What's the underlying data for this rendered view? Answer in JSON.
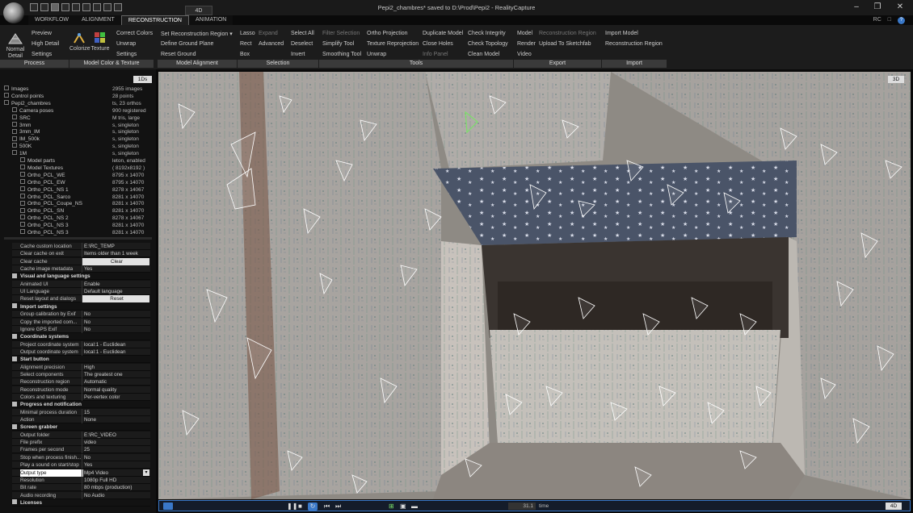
{
  "app": {
    "window_title": "Pepi2_chambres* saved to D:\\Prod\\Pepi2 - RealityCapture",
    "mode_label": "4D",
    "accent": "#3a78c8"
  },
  "tabs": [
    "WORKFLOW",
    "ALIGNMENT",
    "RECONSTRUCTION",
    "ANIMATION"
  ],
  "tab_icons": [
    "RC",
    "doc-icon",
    "help-icon"
  ],
  "ribbon": {
    "process": {
      "label": "Process",
      "normal_detail": "Normal Detail",
      "preview": "Preview",
      "high_detail": "High Detail",
      "settings": "Settings"
    },
    "model_color": {
      "label": "Model Color & Texture",
      "colorize": "Colorize",
      "texture": "Texture",
      "correct_colors": "Correct Colors",
      "unwrap": "Unwrap",
      "settings": "Settings"
    },
    "model_alignment": {
      "label": "Model Alignment",
      "set_region": "Set Reconstruction Region",
      "define_ground": "Define Ground Plane",
      "reset_ground": "Reset Ground"
    },
    "selection": {
      "label": "Selection",
      "lasso": "Lasso",
      "expand": "Expand",
      "rect": "Rect",
      "advanced": "Advanced",
      "box": "Box",
      "select_all": "Select All",
      "deselect": "Deselect",
      "invert": "Invert"
    },
    "tools": {
      "label": "Tools",
      "filter_selection": "Filter Selection",
      "simplify_tool": "Simplify Tool",
      "smoothing_tool": "Smoothing Tool",
      "ortho_projection": "Ortho Projection",
      "texture_reprojection": "Texture Reprojection",
      "unwrap": "Unwrap",
      "duplicate_model": "Duplicate Model",
      "close_holes": "Close Holes",
      "info_panel": "Info Panel",
      "check_integrity": "Check Integrity",
      "check_topology": "Check Topology",
      "clean_model": "Clean Model"
    },
    "export": {
      "label": "Export",
      "model": "Model",
      "reconstruction_region": "Reconstruction Region",
      "render": "Render",
      "upload_sketchfab": "Upload To Sketchfab",
      "video": "Video"
    },
    "import": {
      "label": "Import",
      "import_model": "Import Model",
      "reconstruction_region": "Reconstruction Region"
    }
  },
  "tree": {
    "badge": "1Ds",
    "rows": [
      {
        "name": "Images",
        "value": "2955 images",
        "level": 0
      },
      {
        "name": "Control points",
        "value": "28 points",
        "level": 0
      },
      {
        "name": "Pepi2_chambres",
        "value": "ts, 23 orthos",
        "level": 0
      },
      {
        "name": "Camera poses",
        "value": "900 registered",
        "level": 1
      },
      {
        "name": "SRC",
        "value": "M tris, large",
        "level": 1
      },
      {
        "name": "3mm",
        "value": "s, singleton",
        "level": 1
      },
      {
        "name": "3mm_IM",
        "value": "s, singleton",
        "level": 1
      },
      {
        "name": "IM_500k",
        "value": "s, singleton",
        "level": 1
      },
      {
        "name": "500K",
        "value": "s, singleton",
        "level": 1
      },
      {
        "name": "1M",
        "value": "s, singleton",
        "level": 1
      },
      {
        "name": "Model parts",
        "value": "leton, enabled",
        "level": 2
      },
      {
        "name": "Model Textures",
        "value": "( 8192x8192 )",
        "level": 2
      },
      {
        "name": "Ortho_PCL_WE",
        "value": "8795 x 14070",
        "level": 2
      },
      {
        "name": "Ortho_PCL_EW",
        "value": "8795 x 14070",
        "level": 2
      },
      {
        "name": "Ortho_PCL_NS 1",
        "value": "8278 x 14067",
        "level": 2
      },
      {
        "name": "Ortho_PCL_Sarco",
        "value": "8281 x 14070",
        "level": 2
      },
      {
        "name": "Ortho_PCL_Coupe_NS",
        "value": "8281 x 14070",
        "level": 2
      },
      {
        "name": "Ortho_PCL_SN",
        "value": "8281 x 14070",
        "level": 2
      },
      {
        "name": "Ortho_PCL_NS 2",
        "value": "8278 x 14067",
        "level": 2
      },
      {
        "name": "Ortho_PCL_NS 3",
        "value": "8281 x 14070",
        "level": 2
      },
      {
        "name": "Ortho_PCL_NS 3",
        "value": "8281 x 14070",
        "level": 2
      }
    ]
  },
  "settings": {
    "rows": [
      {
        "type": "kv",
        "key": "Cache custom location",
        "value": "E:\\RC_TEMP"
      },
      {
        "type": "kv",
        "key": "Clear cache on exit",
        "value": "Items older than 1 week"
      },
      {
        "type": "btn",
        "key": "Clear cache",
        "value": "Clear"
      },
      {
        "type": "kv",
        "key": "Cache image metadata",
        "value": "Yes"
      },
      {
        "type": "sec",
        "key": "Visual and language settings"
      },
      {
        "type": "kv",
        "key": "Animated UI",
        "value": "Enable"
      },
      {
        "type": "kv",
        "key": "UI Language",
        "value": "Default language"
      },
      {
        "type": "btn",
        "key": "Reset layout and dialogs",
        "value": "Reset"
      },
      {
        "type": "sec",
        "key": "Import settings"
      },
      {
        "type": "kv",
        "key": "Group calibration by Exif",
        "value": "No"
      },
      {
        "type": "kv",
        "key": "Copy the imported com...",
        "value": "No"
      },
      {
        "type": "kv",
        "key": "Ignore GPS Exif",
        "value": "No"
      },
      {
        "type": "sec",
        "key": "Coordinate systems"
      },
      {
        "type": "kv",
        "key": "Project coordinate system",
        "value": "local:1 - Euclidean"
      },
      {
        "type": "kv",
        "key": "Output coordinate system",
        "value": "local:1 - Euclidean"
      },
      {
        "type": "sec",
        "key": "Start button"
      },
      {
        "type": "kv",
        "key": "Alignment precision",
        "value": "High"
      },
      {
        "type": "kv",
        "key": "Select components",
        "value": "The greatest one"
      },
      {
        "type": "kv",
        "key": "Reconstruction region",
        "value": "Automatic"
      },
      {
        "type": "kv",
        "key": "Reconstruction mode",
        "value": "Normal quality"
      },
      {
        "type": "kv",
        "key": "Colors and texturing",
        "value": "Per-vertex color"
      },
      {
        "type": "sec",
        "key": "Progress end notification"
      },
      {
        "type": "kv",
        "key": "Minimal process duration",
        "value": "15"
      },
      {
        "type": "kv",
        "key": "Action",
        "value": "None"
      },
      {
        "type": "sec",
        "key": "Screen grabber"
      },
      {
        "type": "kv",
        "key": "Output folder",
        "value": "E:\\RC_VIDEO"
      },
      {
        "type": "kv",
        "key": "File prefix",
        "value": "video"
      },
      {
        "type": "kv",
        "key": "Frames per second",
        "value": "25"
      },
      {
        "type": "kv",
        "key": "Stop when process finish...",
        "value": "No"
      },
      {
        "type": "kv",
        "key": "Play a sound on start/stop",
        "value": "Yes"
      },
      {
        "type": "sel",
        "key": "Output type",
        "value": "Mp4 Video"
      },
      {
        "type": "kv",
        "key": "Resolution",
        "value": "1080p Full HD"
      },
      {
        "type": "kv",
        "key": "Bit rate",
        "value": "80 mbps (production)"
      },
      {
        "type": "kv",
        "key": "Audio recording",
        "value": "No Audio"
      },
      {
        "type": "sec",
        "key": "Licenses"
      }
    ]
  },
  "viewport": {
    "badge": "3D"
  },
  "timeline": {
    "time_value": "31.1",
    "time_label": "time",
    "mode_label": "4D",
    "buttons": [
      "pause-icon",
      "stop-icon",
      "loop-icon",
      "prev-icon",
      "next-icon"
    ]
  }
}
